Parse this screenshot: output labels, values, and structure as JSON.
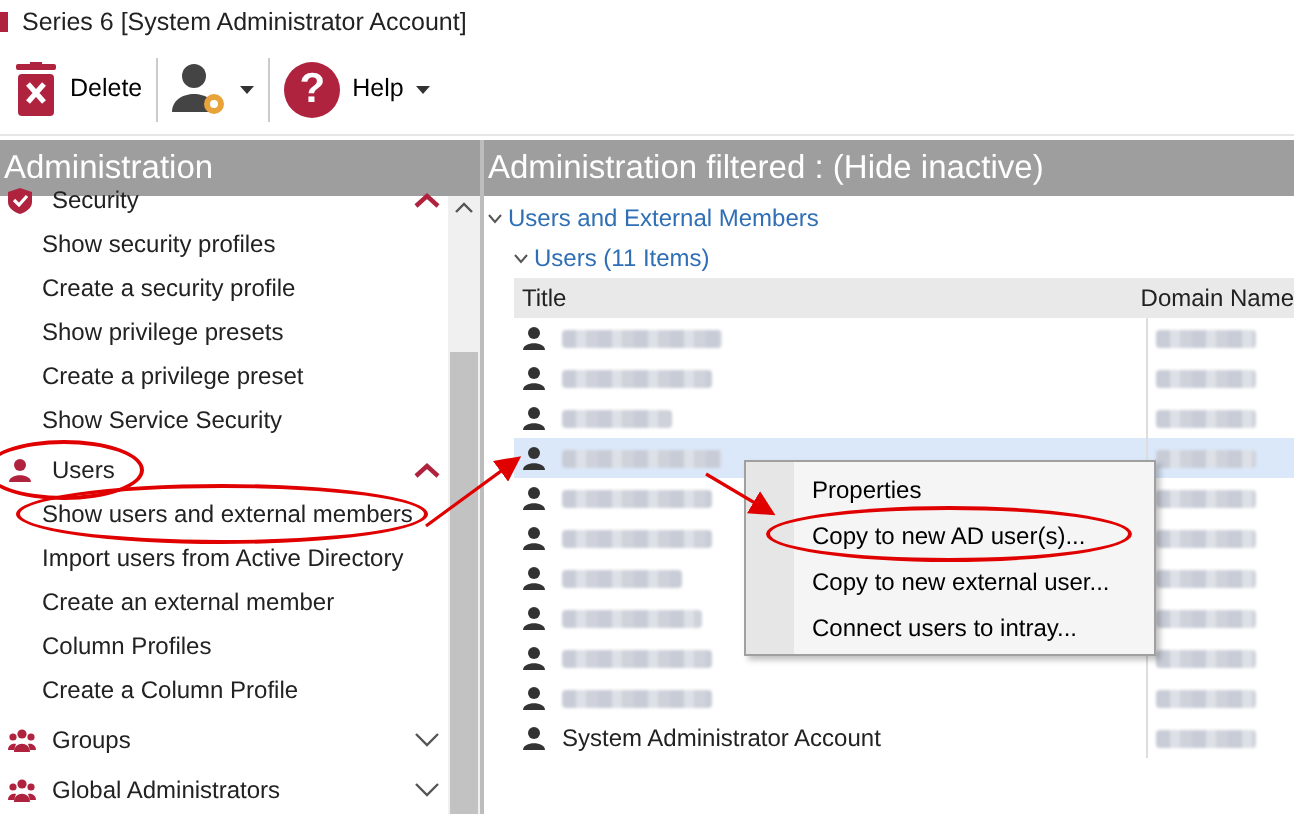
{
  "window": {
    "title": "Series 6 [System Administrator Account]"
  },
  "toolbar": {
    "delete_label": "Delete",
    "help_label": "Help",
    "help_glyph": "?"
  },
  "left_panel": {
    "title": "Administration",
    "sections": [
      {
        "label": "Security",
        "kind": "shield",
        "expanded": true,
        "highlighted": false,
        "items": [
          {
            "label": "Show security profiles",
            "highlighted": false
          },
          {
            "label": "Create a security profile",
            "highlighted": false
          },
          {
            "label": "Show privilege presets",
            "highlighted": false
          },
          {
            "label": "Create a privilege preset",
            "highlighted": false
          },
          {
            "label": "Show Service Security",
            "highlighted": false
          }
        ]
      },
      {
        "label": "Users",
        "kind": "user",
        "expanded": true,
        "highlighted": true,
        "items": [
          {
            "label": "Show users and external members",
            "highlighted": true
          },
          {
            "label": "Import users from Active Directory",
            "highlighted": false
          },
          {
            "label": "Create an external member",
            "highlighted": false
          },
          {
            "label": "Column Profiles",
            "highlighted": false
          },
          {
            "label": "Create a Column Profile",
            "highlighted": false
          }
        ]
      },
      {
        "label": "Groups",
        "kind": "group",
        "expanded": false,
        "highlighted": false
      },
      {
        "label": "Global Administrators",
        "kind": "group",
        "expanded": false,
        "highlighted": false
      }
    ]
  },
  "right_panel": {
    "title": "Administration filtered : (Hide inactive)",
    "group": "Users and External Members",
    "subgroup": "Users (11 Items)",
    "columns": [
      "Title",
      "Domain Name"
    ],
    "rows": [
      {
        "redacted": true,
        "selected": false
      },
      {
        "redacted": true,
        "selected": false
      },
      {
        "redacted": true,
        "selected": false
      },
      {
        "redacted": true,
        "selected": true
      },
      {
        "redacted": true,
        "selected": false
      },
      {
        "redacted": true,
        "selected": false
      },
      {
        "redacted": true,
        "selected": false
      },
      {
        "redacted": true,
        "selected": false
      },
      {
        "redacted": true,
        "selected": false
      },
      {
        "redacted": true,
        "selected": false
      },
      {
        "redacted": false,
        "title": "System Administrator Account",
        "selected": false
      }
    ]
  },
  "context_menu": {
    "items": [
      {
        "label": "Properties",
        "highlighted": false
      },
      {
        "label": "Copy to new AD user(s)...",
        "highlighted": true
      },
      {
        "label": "Copy to new external user...",
        "highlighted": false
      },
      {
        "label": "Connect users to intray...",
        "highlighted": false
      }
    ]
  }
}
